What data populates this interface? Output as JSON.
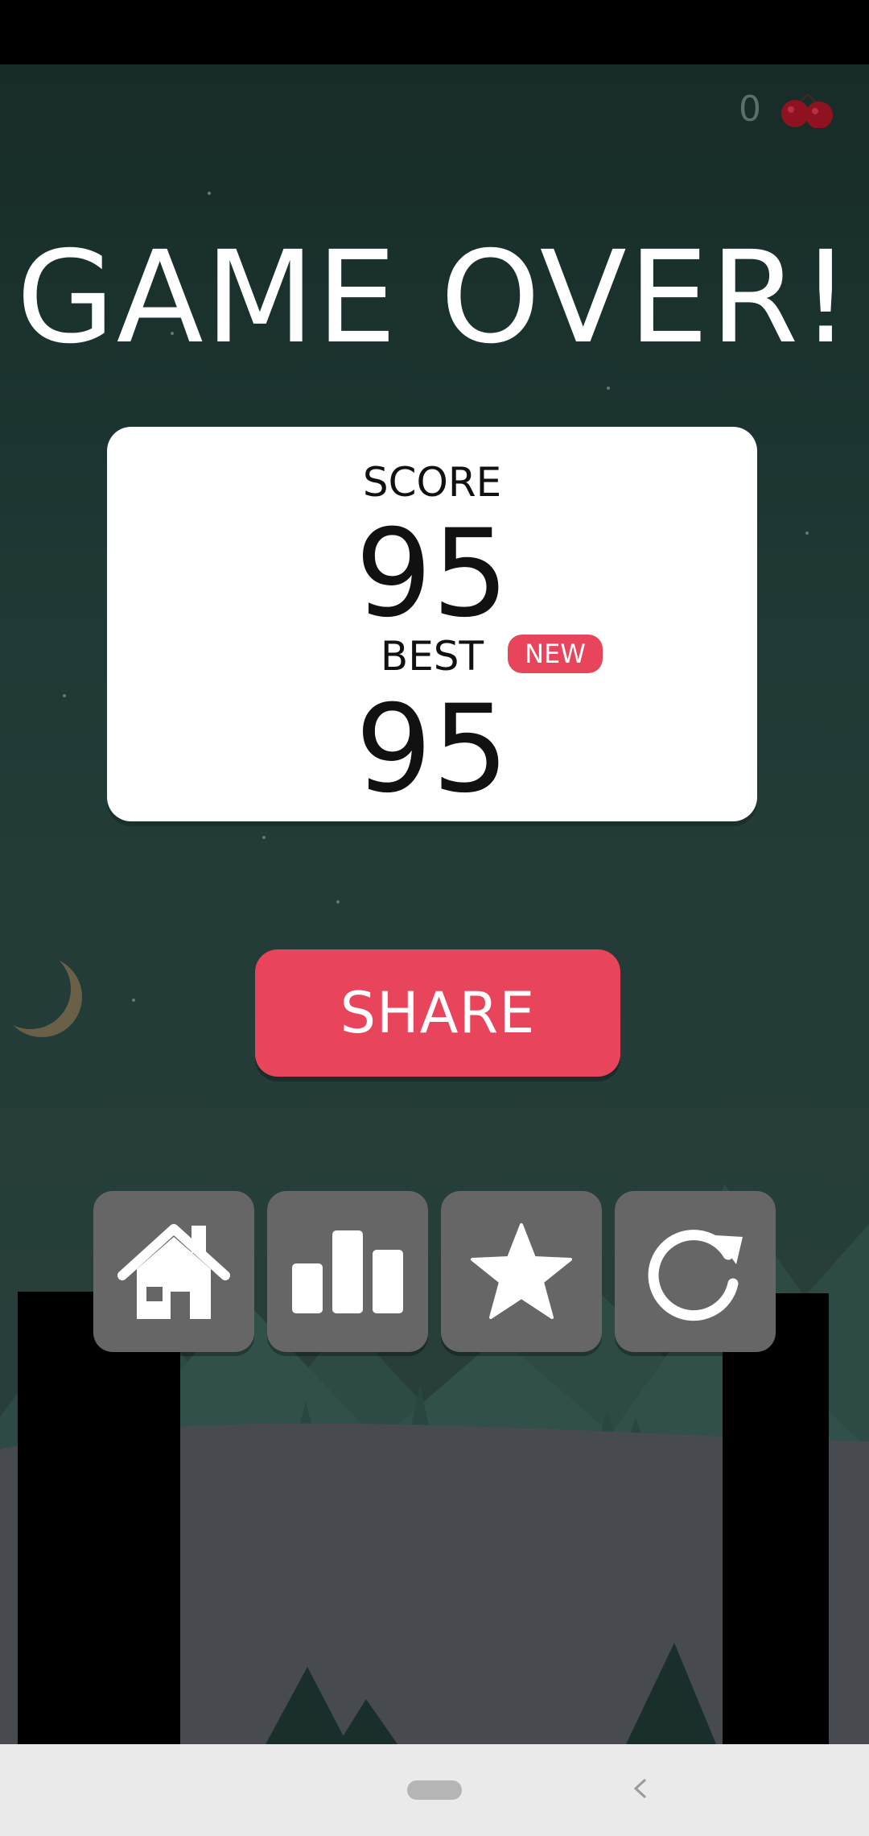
{
  "hud": {
    "cherry_count": "0",
    "cherry_icon": "cherry-icon"
  },
  "title": "GAME OVER!",
  "score_card": {
    "score_label": "SCORE",
    "score_value": "95",
    "best_label": "BEST",
    "new_badge": "NEW",
    "best_value": "95"
  },
  "share_button": "SHARE",
  "menu_buttons": [
    {
      "name": "home-button",
      "icon": "home-icon"
    },
    {
      "name": "leaderboard-button",
      "icon": "bar-chart-icon"
    },
    {
      "name": "rate-button",
      "icon": "star-icon"
    },
    {
      "name": "restart-button",
      "icon": "restart-icon"
    }
  ],
  "colors": {
    "accent": "#e8445b",
    "button_gray": "#666666",
    "background_top": "#172b28",
    "background_bottom": "#2b403d"
  }
}
